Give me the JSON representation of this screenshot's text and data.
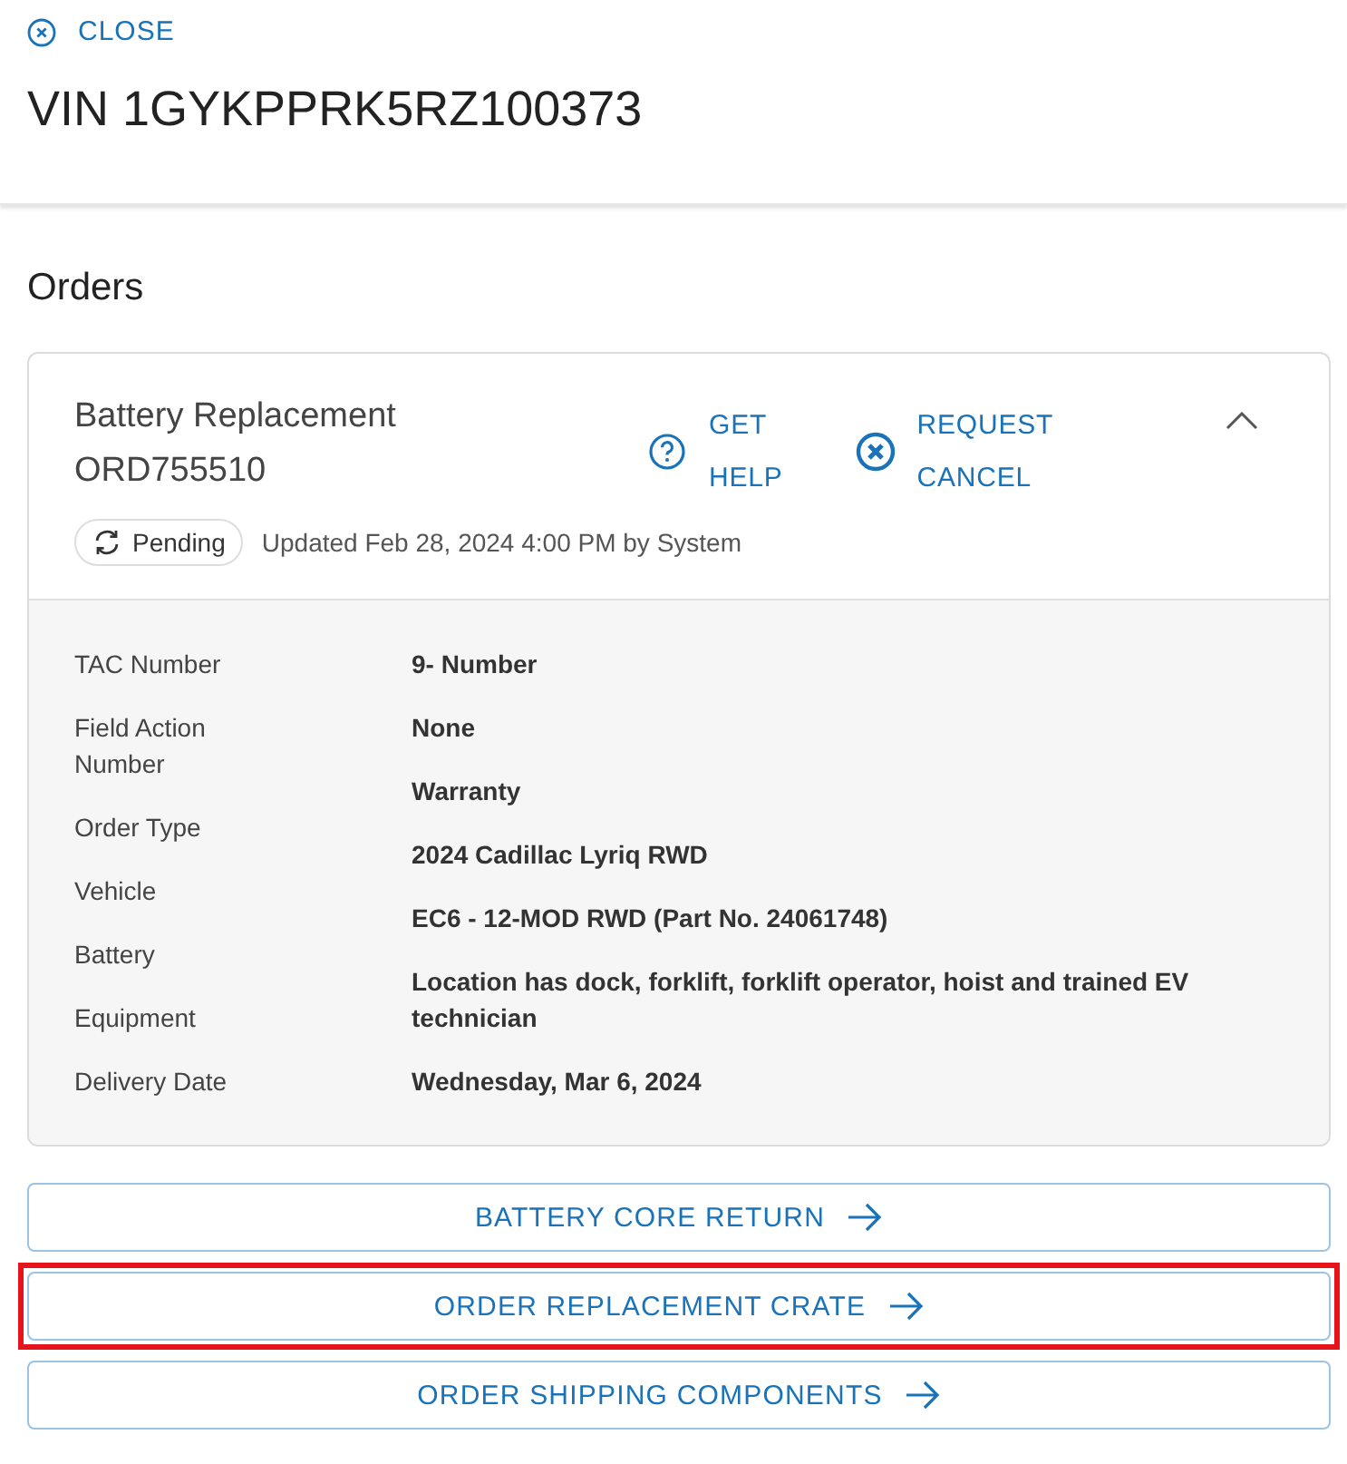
{
  "close_link": "CLOSE",
  "title": "VIN 1GYKPPRK5RZ100373",
  "section_title": "Orders",
  "order": {
    "name": "Battery Replacement",
    "number": "ORD755510",
    "expanded": true,
    "actions": [
      {
        "kind": "help",
        "label_lines": [
          "GET",
          "HELP"
        ]
      },
      {
        "kind": "cancel",
        "label_lines": [
          "REQUEST",
          "CANCEL"
        ]
      }
    ],
    "status": "Pending",
    "updated": "Updated Feb 28, 2024 4:00 PM by System",
    "labels": [
      "TAC Number",
      "Field Action Number",
      "Order Type",
      "Vehicle",
      "Battery",
      "Equipment",
      "Delivery Date"
    ],
    "values": [
      "9- Number",
      "None",
      "Warranty",
      "2024 Cadillac Lyriq RWD",
      "EC6 - 12-MOD RWD (Part No. 24061748)",
      "Location has dock, forklift, forklift operator, hoist and trained EV technician",
      "Wednesday, Mar 6, 2024"
    ]
  },
  "buttons": [
    {
      "label": "BATTERY CORE RETURN",
      "highlighted": false
    },
    {
      "label": "ORDER REPLACEMENT CRATE",
      "highlighted": true
    },
    {
      "label": "ORDER SHIPPING COMPONENTS",
      "highlighted": false
    }
  ]
}
